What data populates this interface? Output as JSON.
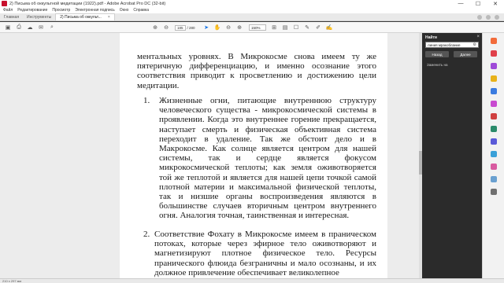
{
  "window": {
    "title": "2) Письма об оккультной медитации (1922).pdf - Adobe Acrobat Pro DC (32-bit)",
    "minimize": "—",
    "maximize": "☐",
    "close": "✕"
  },
  "menu": [
    "Файл",
    "Редактирование",
    "Просмотр",
    "Электронная подпись",
    "Окно",
    "Справка"
  ],
  "tabs": {
    "home": "Главная",
    "tools": "Инструменты",
    "document": "2) Письма об оккульт...",
    "close": "×"
  },
  "toolbar": {
    "page_current": "185",
    "page_total": "/ 280",
    "zoom": "150%"
  },
  "document": {
    "intro": "ментальных уровнях. В Микрокосме снова имеем ту же пятеричную дифференциацию, и именно осознание этого соответствия приводит к просветлению и достижению цели медитации.",
    "items": [
      {
        "number": "1.",
        "text": "Жизненные огни, питающие внутреннюю структуру человеческого существа - микрокосмической системы в проявлении. Когда это внутреннее горение прекращается, наступает смерть и физическая объективная система переходит в удаление. Так же обстоит дело и в Макрокосме. Как солнце является центром для нашей системы, так и сердце является фокусом микрокосмической теплоты; как земля оживотворяется той же теплотой и является для нашей цепи точкой самой плотной материи и максимальной физической теплоты, так и низшие органы воспроизведения являются в большинстве случаев вторичным центром внутреннего огня. Аналогия точная, таинственная и интересная."
      },
      {
        "number": "2.",
        "text": "Соответствие Фохату в Микрокосме имеем в праническом потоках, которые через эфирное тело оживотворяют и магнетизируют плотное физическое тело. Ресурсы пранического флюида безграничны и мало осознаны, и их должное привлечение обеспечивает великолепное"
      }
    ]
  },
  "find_panel": {
    "title": "Найти",
    "close": "×",
    "query": "линия мракоблание",
    "settings_icon": "⚙",
    "prev_label": "Назад",
    "next_label": "Далее",
    "replace_label": "Заменить на"
  },
  "status": {
    "page_size": "210 x 297 мм"
  },
  "colors": {
    "accent": "#c8102e",
    "panel_bg": "#2b2b2b"
  }
}
